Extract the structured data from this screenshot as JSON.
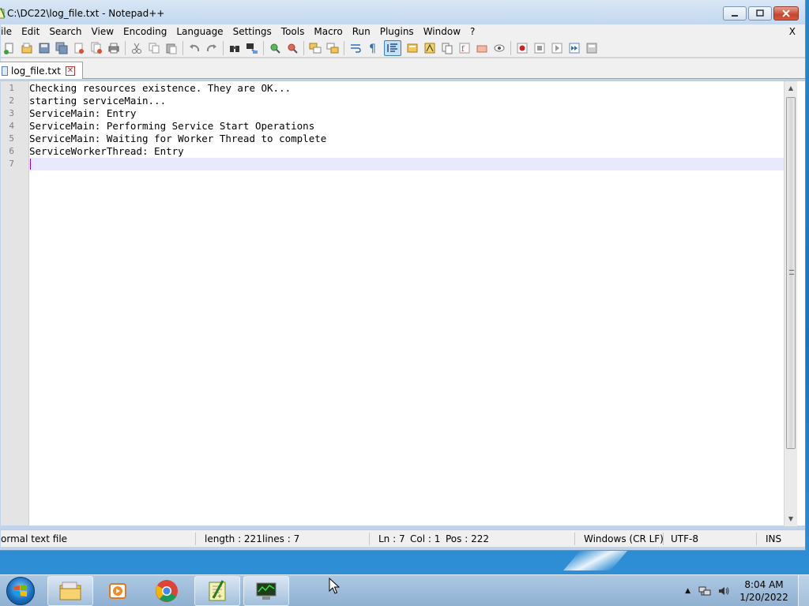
{
  "window": {
    "title": "C:\\DC22\\log_file.txt - Notepad++"
  },
  "menubar": {
    "items": [
      "ile",
      "Edit",
      "Search",
      "View",
      "Encoding",
      "Language",
      "Settings",
      "Tools",
      "Macro",
      "Run",
      "Plugins",
      "Window",
      "?"
    ],
    "close_label": "X"
  },
  "toolbar": {
    "icons": [
      "new-file-icon",
      "open-file-icon",
      "save-icon",
      "save-all-icon",
      "close-icon",
      "close-all-icon",
      "print-icon",
      "cut-icon",
      "copy-icon",
      "paste-icon",
      "undo-icon",
      "redo-icon",
      "find-icon",
      "replace-icon",
      "zoom-in-icon",
      "zoom-out-icon",
      "sync-vertical-icon",
      "sync-horizontal-icon",
      "word-wrap-icon",
      "show-all-chars-icon",
      "indent-guide-icon",
      "user-language-icon",
      "doc-map-icon",
      "function-list-icon",
      "folder-workspace-icon",
      "monitoring-icon",
      "record-macro-icon",
      "stop-macro-icon",
      "play-macro-icon",
      "run-macro-multiple-icon",
      "save-macro-icon"
    ]
  },
  "tabs": [
    {
      "label": "log_file.txt",
      "close": "✕"
    }
  ],
  "editor": {
    "lines": [
      {
        "num": "1",
        "text": "Checking resources existence. They are OK..."
      },
      {
        "num": "2",
        "text": "starting serviceMain..."
      },
      {
        "num": "3",
        "text": "ServiceMain: Entry"
      },
      {
        "num": "4",
        "text": "ServiceMain: Performing Service Start Operations"
      },
      {
        "num": "5",
        "text": "ServiceMain: Waiting for Worker Thread to complete"
      },
      {
        "num": "6",
        "text": "ServiceWorkerThread: Entry"
      },
      {
        "num": "7",
        "text": ""
      }
    ]
  },
  "statusbar": {
    "file_type": "ormal text file",
    "length": "length : 221",
    "lines": "lines : 7",
    "ln": "Ln : 7",
    "col": "Col : 1",
    "pos": "Pos : 222",
    "eol": "Windows (CR LF)",
    "encoding": "UTF-8",
    "mode": "INS"
  },
  "taskbar": {
    "apps": [
      "file-explorer-icon",
      "media-player-icon",
      "chrome-icon",
      "notepad-plus-plus-icon",
      "network-monitor-icon"
    ],
    "clock_time": "8:04 AM",
    "clock_date": "1/20/2022"
  },
  "colors": {
    "current_line": "#e8e8ff",
    "caret": "#8000ff",
    "accent": "#1a73bd"
  }
}
